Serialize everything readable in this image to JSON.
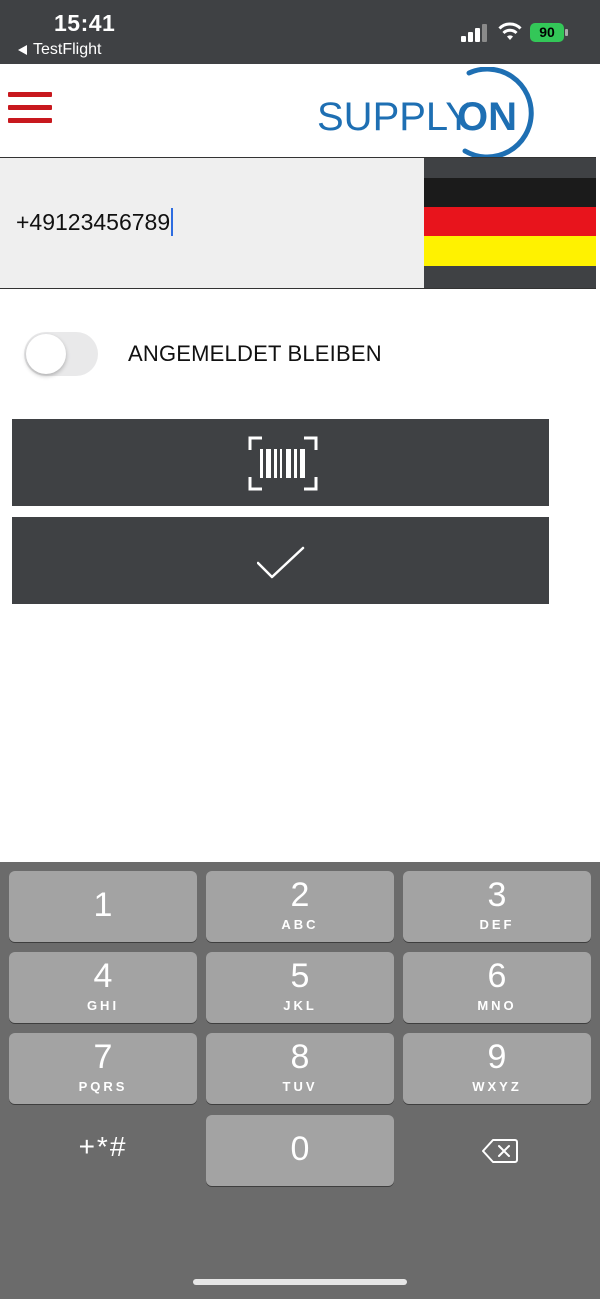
{
  "status_bar": {
    "time": "15:41",
    "back_label": "TestFlight",
    "battery": "90"
  },
  "header": {
    "logo_text": "SUPPLYON",
    "menu_icon": "hamburger-icon",
    "brand_color": "#c8181e",
    "logo_color": "#1e6fb3"
  },
  "phone": {
    "value": "+49123456789",
    "country_flag": "germany-flag-icon"
  },
  "stay_logged_in": {
    "label": "ANGEMELDET BLEIBEN",
    "on": false
  },
  "actions": {
    "scan_icon": "barcode-scan-icon",
    "confirm_icon": "checkmark-icon"
  },
  "keypad": {
    "keys": [
      {
        "num": "1",
        "letters": ""
      },
      {
        "num": "2",
        "letters": "ABC"
      },
      {
        "num": "3",
        "letters": "DEF"
      },
      {
        "num": "4",
        "letters": "GHI"
      },
      {
        "num": "5",
        "letters": "JKL"
      },
      {
        "num": "6",
        "letters": "MNO"
      },
      {
        "num": "7",
        "letters": "PQRS"
      },
      {
        "num": "8",
        "letters": "TUV"
      },
      {
        "num": "9",
        "letters": "WXYZ"
      },
      {
        "num": "0",
        "letters": ""
      }
    ],
    "symbols_label": "+*#",
    "delete_icon": "backspace-icon"
  }
}
